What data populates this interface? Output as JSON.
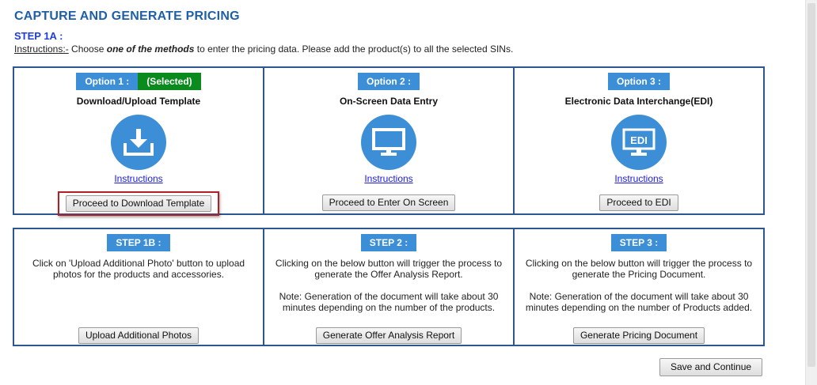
{
  "page": {
    "title": "CAPTURE AND GENERATE PRICING",
    "step_label": "STEP 1A :",
    "instructions_prefix": "Instructions:-",
    "instructions_text_1": " Choose ",
    "instructions_emphasis": "one of the methods",
    "instructions_text_2": " to enter the pricing data. Please add the product(s) to all the selected SINs."
  },
  "options": [
    {
      "badge": "Option 1 :",
      "selected_label": "(Selected)",
      "title": "Download/Upload Template",
      "icon": "download-tray-icon",
      "link": "Instructions ",
      "button": "Proceed to Download Template"
    },
    {
      "badge": "Option 2 :",
      "title": "On-Screen Data Entry",
      "icon": "monitor-icon",
      "link": "Instructions ",
      "button": "Proceed to Enter On Screen"
    },
    {
      "badge": "Option 3 :",
      "title": "Electronic Data Interchange(EDI)",
      "icon": "edi-monitor-icon",
      "icon_text": "EDI",
      "link": "Instructions",
      "button": "Proceed to EDI"
    }
  ],
  "steps": [
    {
      "badge": "STEP 1B :",
      "desc": "Click on 'Upload Additional Photo' button to upload photos for the products and accessories.",
      "note": "",
      "button": "Upload Additional Photos"
    },
    {
      "badge": "STEP 2 :",
      "desc": "Clicking on the below button will trigger the process to generate the Offer Analysis Report.",
      "note": "Note: Generation of the document will take about 30 minutes depending on the number of the products.",
      "button": "Generate Offer Analysis Report"
    },
    {
      "badge": "STEP 3 :",
      "desc": "Clicking on the below button will trigger the process to generate the Pricing Document.",
      "note": "Note: Generation of the document will take about 30 minutes depending on the number of Products added.",
      "button": "Generate Pricing Document"
    }
  ],
  "footer": {
    "save_button": "Save and Continue"
  },
  "colors": {
    "title": "#1f5fa8",
    "badge": "#3c8fd6",
    "selected_badge": "#0b8a1e",
    "border": "#2d5591",
    "highlight": "#b21f24"
  }
}
